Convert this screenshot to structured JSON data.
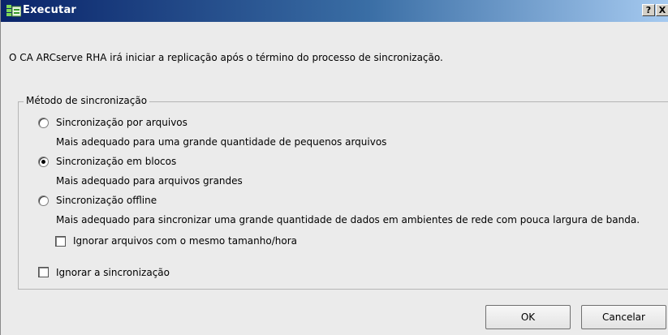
{
  "window": {
    "title": "Executar",
    "help_button": "?",
    "close_button": "X"
  },
  "message": "O CA ARCserve RHA irá iniciar a replicação após o término do processo de sincronização.",
  "sync_method": {
    "group_title": "Método de sincronização",
    "selected": "block",
    "options": [
      {
        "label": "Sincronização por arquivos",
        "description": "Mais adequado para uma grande quantidade de pequenos arquivos",
        "checked": false
      },
      {
        "label": "Sincronização em blocos",
        "description": "Mais adequado para arquivos grandes",
        "checked": true
      },
      {
        "label": "Sincronização offline",
        "description": "Mais adequado para sincronizar uma grande quantidade de dados em ambientes de rede com pouca largura de banda.",
        "checked": false
      }
    ],
    "ignore_same_size_label": "Ignorar arquivos com o mesmo tamanho/hora",
    "ignore_same_size_checked": false,
    "ignore_sync_label": "Ignorar a sincronização",
    "ignore_sync_checked": false
  },
  "buttons": {
    "ok": "OK",
    "cancel": "Cancelar"
  },
  "colors": {
    "titlebar_start": "#0a246a",
    "titlebar_end": "#a6caf0",
    "dialog_bg": "#ebebeb"
  },
  "icons": {
    "title_icon": "app-window-icon"
  }
}
